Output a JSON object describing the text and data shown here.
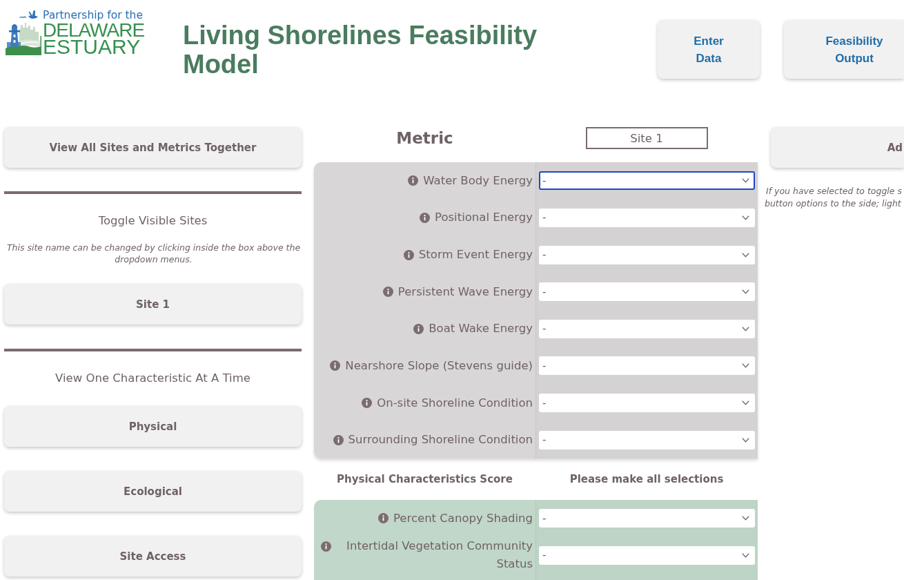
{
  "logo": {
    "tagline": "Partnership for the",
    "line_1": "DELAWARE",
    "line_2": "ESTUARY"
  },
  "title": "Living Shorelines Feasibility Model",
  "nav_buttons": [
    {
      "label": "Enter Data"
    },
    {
      "label": "Feasibility Output"
    }
  ],
  "sidebar": {
    "view_all_button": "View All Sites and Metrics Together",
    "toggle_heading": "Toggle Visible Sites",
    "toggle_note": "This site name can be changed by clicking inside the box above the dropdown menus.",
    "site_buttons": [
      {
        "label": "Site 1"
      }
    ],
    "characteristic_heading": "View One Characteristic At A Time",
    "characteristic_buttons": [
      {
        "label": "Physical"
      },
      {
        "label": "Ecological"
      },
      {
        "label": "Site Access"
      }
    ]
  },
  "metrics": {
    "heading": "Metric",
    "site_name": "Site 1",
    "sections": [
      {
        "kind": "physical",
        "rows": [
          {
            "label": "Water Body Energy",
            "value": "-",
            "focused": true
          },
          {
            "label": "Positional Energy",
            "value": "-",
            "focused": false
          },
          {
            "label": "Storm Event Energy",
            "value": "-",
            "focused": false
          },
          {
            "label": "Persistent Wave Energy",
            "value": "-",
            "focused": false
          },
          {
            "label": "Boat Wake Energy",
            "value": "-",
            "focused": false
          },
          {
            "label": "Nearshore Slope (Stevens guide)",
            "value": "-",
            "focused": false
          },
          {
            "label": "On-site Shoreline Condition",
            "value": "-",
            "focused": false
          },
          {
            "label": "Surrounding Shoreline Condition",
            "value": "-",
            "focused": false
          }
        ],
        "score_label": "Physical Characteristics Score",
        "score_value": "Please make all selections"
      },
      {
        "kind": "ecological",
        "rows": [
          {
            "label": "Percent Canopy Shading",
            "value": "-",
            "focused": false
          },
          {
            "label": "Intertidal Vegetation Community Status",
            "value": "-",
            "focused": false
          }
        ]
      }
    ]
  },
  "side_panel": {
    "button_label": "Ad",
    "note_lines": [
      "If you have selected to toggle s",
      "button options to the side; light"
    ]
  }
}
